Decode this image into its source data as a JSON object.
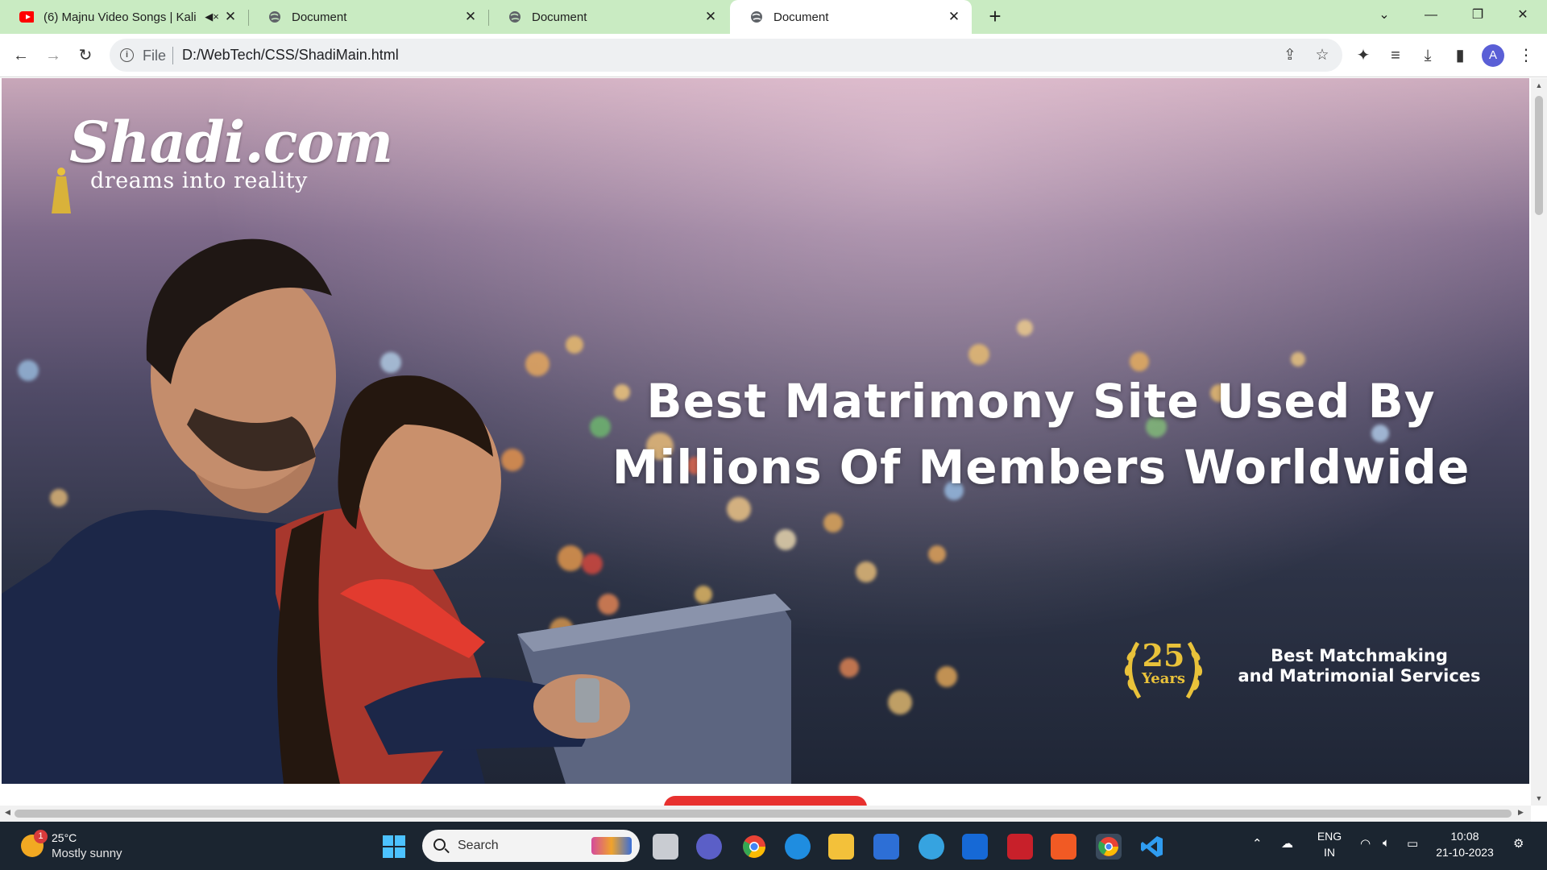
{
  "browser": {
    "tabs": [
      {
        "title": "(6) Majnu Video Songs | Kali",
        "favicon": "youtube-icon",
        "muted": true
      },
      {
        "title": "Document",
        "favicon": "globe-icon"
      },
      {
        "title": "Document",
        "favicon": "globe-icon"
      },
      {
        "title": "Document",
        "favicon": "globe-icon",
        "active": true
      }
    ],
    "new_tab": "+",
    "address": {
      "scheme_label": "File",
      "url": "D:/WebTech/CSS/ShadiMain.html"
    },
    "profile_initial": "A",
    "tabbar_color": "#c9ebc2"
  },
  "page": {
    "logo": {
      "brand": "Shadi.com",
      "tagline": "dreams into reality"
    },
    "headline": [
      "Best Matrimony Site Used By",
      "Millions Of Members Worldwide"
    ],
    "badge": {
      "number": "25",
      "label": "Years"
    },
    "slogan": [
      "Best Matchmaking",
      "and Matrimonial Services"
    ],
    "accent_color": "#e8312f"
  },
  "taskbar": {
    "weather": {
      "temp": "25°C",
      "condition": "Mostly sunny",
      "alerts": "1"
    },
    "search_label": "Search",
    "language": [
      "ENG",
      "IN"
    ],
    "time": "10:08",
    "date": "21-10-2023"
  }
}
